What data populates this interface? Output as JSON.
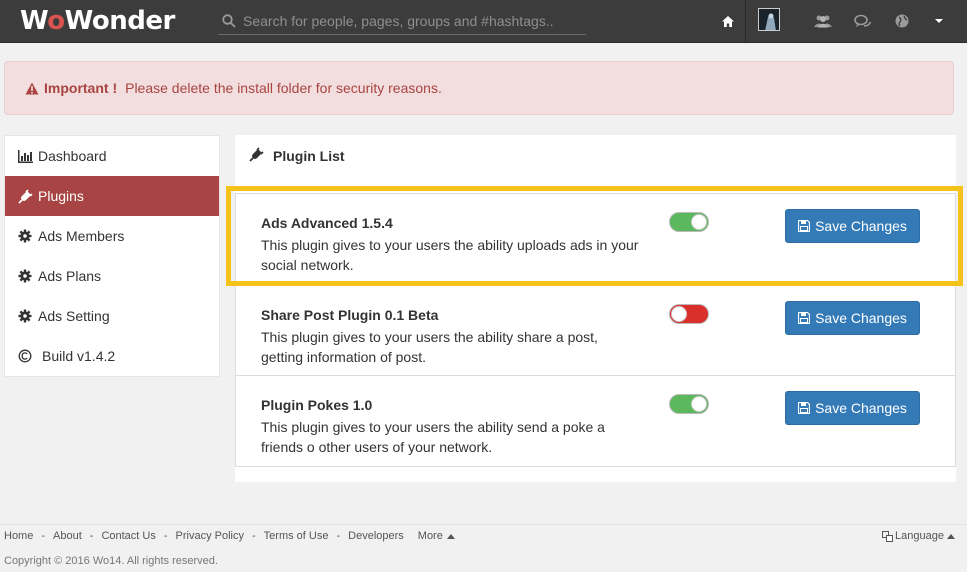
{
  "navbar": {
    "logo_text_1": "W",
    "logo_text_2": "o",
    "logo_text_3": "Wonder",
    "search_placeholder": "Search for people, pages, groups and #hashtags..",
    "icons": [
      "home-icon",
      "avatar",
      "users-icon",
      "chat-icon",
      "globe-icon",
      "caret-down-icon"
    ]
  },
  "alert": {
    "title": "Important !",
    "message": "Please delete the install folder for security reasons."
  },
  "sidebar": {
    "items": [
      {
        "label": "Dashboard",
        "icon": "bar-chart-icon",
        "active": false
      },
      {
        "label": "Plugins",
        "icon": "plug-icon",
        "active": true
      },
      {
        "label": "Ads Members",
        "icon": "gear-icon",
        "active": false
      },
      {
        "label": "Ads Plans",
        "icon": "gear-icon",
        "active": false
      },
      {
        "label": "Ads Setting",
        "icon": "gear-icon",
        "active": false
      },
      {
        "label": "Build v1.4.2",
        "icon": "copyright-icon",
        "active": false
      }
    ]
  },
  "main": {
    "title": "Plugin List",
    "plugins": [
      {
        "name": "Ads Advanced 1.5.4",
        "description": "This plugin gives to your users the ability uploads ads in your social network.",
        "enabled": true,
        "button": "Save Changes"
      },
      {
        "name": "Share Post Plugin 0.1 Beta",
        "description": "This plugin gives to your users the ability share a post, getting information of post.",
        "enabled": false,
        "button": "Save Changes"
      },
      {
        "name": "Plugin Pokes 1.0",
        "description": "This plugin gives to your users the ability send a poke a friends o other users of your network.",
        "enabled": true,
        "button": "Save Changes"
      }
    ]
  },
  "footer": {
    "links": [
      "Home",
      "About",
      "Contact Us",
      "Privacy Policy",
      "Terms of Use",
      "Developers"
    ],
    "separator": "-",
    "more": "More",
    "language": "Language",
    "copyright": "Copyright © 2016 Wo14. All rights reserved."
  },
  "colors": {
    "navbar": "#3c3c3c",
    "accent_active": "#a84443",
    "primary_button": "#337ab7",
    "toggle_on": "#5cb85c",
    "toggle_off": "#d9302b",
    "highlight": "#f6c21a",
    "alert_bg": "#f2dede",
    "alert_text": "#a94442"
  }
}
